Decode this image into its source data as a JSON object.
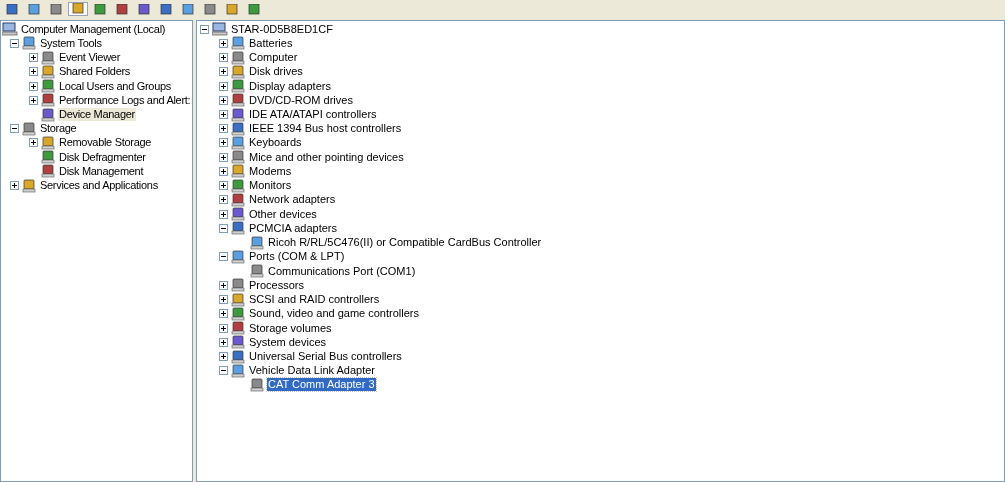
{
  "toolbar": {
    "buttons": [
      {
        "pressed": false
      },
      {
        "pressed": false
      },
      {
        "pressed": false
      },
      {
        "pressed": true
      },
      {
        "pressed": false
      },
      {
        "pressed": false
      },
      {
        "pressed": false
      },
      {
        "pressed": false
      },
      {
        "pressed": false
      },
      {
        "pressed": false
      },
      {
        "pressed": false
      },
      {
        "pressed": false
      }
    ]
  },
  "console_tree": {
    "items": [
      {
        "label": "Computer Management (Local)",
        "selected": false,
        "children": [
          {
            "label": "System Tools",
            "expanded": true,
            "selected": false,
            "children": [
              {
                "label": "Event Viewer",
                "expanded": false,
                "selected": false
              },
              {
                "label": "Shared Folders",
                "expanded": false,
                "selected": false
              },
              {
                "label": "Local Users and Groups",
                "expanded": false,
                "selected": false
              },
              {
                "label": "Performance Logs and Alert:",
                "expanded": false,
                "selected": false
              },
              {
                "label": "Device Manager",
                "selected": true
              }
            ]
          },
          {
            "label": "Storage",
            "expanded": true,
            "selected": false,
            "children": [
              {
                "label": "Removable Storage",
                "expanded": false,
                "selected": false
              },
              {
                "label": "Disk Defragmenter",
                "selected": false
              },
              {
                "label": "Disk Management",
                "selected": false
              }
            ]
          },
          {
            "label": "Services and Applications",
            "expanded": false,
            "selected": false
          }
        ]
      }
    ]
  },
  "device_tree": {
    "items": [
      {
        "label": "STAR-0D5B8ED1CF",
        "expanded": true,
        "selected": false,
        "children": [
          {
            "label": "Batteries",
            "expanded": false,
            "selected": false
          },
          {
            "label": "Computer",
            "expanded": false,
            "selected": false
          },
          {
            "label": "Disk drives",
            "expanded": false,
            "selected": false
          },
          {
            "label": "Display adapters",
            "expanded": false,
            "selected": false
          },
          {
            "label": "DVD/CD-ROM drives",
            "expanded": false,
            "selected": false
          },
          {
            "label": "IDE ATA/ATAPI controllers",
            "expanded": false,
            "selected": false
          },
          {
            "label": "IEEE 1394 Bus host controllers",
            "expanded": false,
            "selected": false
          },
          {
            "label": "Keyboards",
            "expanded": false,
            "selected": false
          },
          {
            "label": "Mice and other pointing devices",
            "expanded": false,
            "selected": false
          },
          {
            "label": "Modems",
            "expanded": false,
            "selected": false
          },
          {
            "label": "Monitors",
            "expanded": false,
            "selected": false
          },
          {
            "label": "Network adapters",
            "expanded": false,
            "selected": false
          },
          {
            "label": "Other devices",
            "expanded": false,
            "selected": false
          },
          {
            "label": "PCMCIA adapters",
            "expanded": true,
            "selected": false,
            "children": [
              {
                "label": "Ricoh R/RL/5C476(II) or Compatible CardBus Controller",
                "selected": false
              }
            ]
          },
          {
            "label": "Ports (COM & LPT)",
            "expanded": true,
            "selected": false,
            "children": [
              {
                "label": "Communications Port (COM1)",
                "selected": false
              }
            ]
          },
          {
            "label": "Processors",
            "expanded": false,
            "selected": false
          },
          {
            "label": "SCSI and RAID controllers",
            "expanded": false,
            "selected": false
          },
          {
            "label": "Sound, video and game controllers",
            "expanded": false,
            "selected": false
          },
          {
            "label": "Storage volumes",
            "expanded": false,
            "selected": false
          },
          {
            "label": "System devices",
            "expanded": false,
            "selected": false
          },
          {
            "label": "Universal Serial Bus controllers",
            "expanded": false,
            "selected": false
          },
          {
            "label": "Vehicle Data Link Adapter",
            "expanded": true,
            "selected": false,
            "children": [
              {
                "label": "CAT Comm Adapter 3",
                "selected": true
              }
            ]
          }
        ]
      }
    ]
  }
}
